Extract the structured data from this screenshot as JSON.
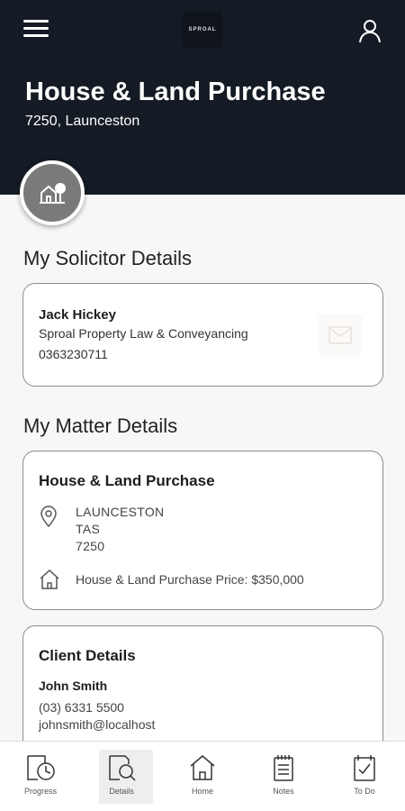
{
  "header": {
    "logo_text": "SPROAL",
    "title": "House & Land Purchase",
    "subtitle": "7250, Launceston"
  },
  "solicitor": {
    "section_title": "My Solicitor Details",
    "name": "Jack Hickey",
    "firm": "Sproal Property Law & Conveyancing",
    "phone": "0363230711"
  },
  "matter": {
    "section_title": "My Matter Details",
    "heading": "House & Land Purchase",
    "address_lines": [
      "LAUNCESTON",
      "TAS",
      "7250"
    ],
    "price_text": "House & Land Purchase Price: $350,000"
  },
  "client": {
    "heading": "Client Details",
    "name": "John Smith",
    "phone": "(03) 6331 5500",
    "email": "johnsmith@localhost"
  },
  "nav": {
    "items": [
      {
        "label": "Progress",
        "icon": "clock-document-icon"
      },
      {
        "label": "Details",
        "icon": "document-search-icon"
      },
      {
        "label": "Home",
        "icon": "home-icon"
      },
      {
        "label": "Notes",
        "icon": "notepad-icon"
      },
      {
        "label": "To Do",
        "icon": "checklist-icon"
      }
    ],
    "active": "Details"
  },
  "colors": {
    "header_bg": "#151b24",
    "page_bg": "#f7f7f8",
    "card_border": "#8c8c8c",
    "avatar_bg": "#7a7a7a"
  }
}
